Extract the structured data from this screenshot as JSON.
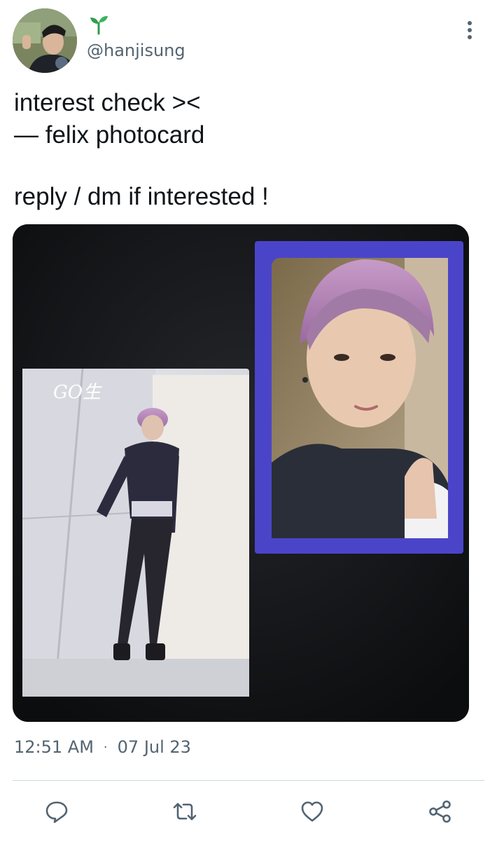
{
  "author": {
    "handle": "@hanjisung",
    "avatar_icon": "user-avatar",
    "badge_icon": "sprout-icon"
  },
  "tweet": {
    "lines": [
      "interest check ><",
      "— felix photocard",
      "",
      "reply / dm if interested !"
    ]
  },
  "meta": {
    "time": "12:51 AM",
    "separator": "·",
    "date": "07 Jul 23"
  },
  "actions": [
    {
      "name": "reply",
      "icon": "reply-icon"
    },
    {
      "name": "retweet",
      "icon": "retweet-icon"
    },
    {
      "name": "like",
      "icon": "heart-icon"
    },
    {
      "name": "share",
      "icon": "share-icon"
    }
  ],
  "media": {
    "album_logo_text": "GO生"
  },
  "colors": {
    "text": "#0f1419",
    "secondary": "#536471",
    "divider": "#cfd9de",
    "sprout": "#2e9e4f",
    "card_border": "#4a45c8",
    "hair": "#b68ab8"
  }
}
